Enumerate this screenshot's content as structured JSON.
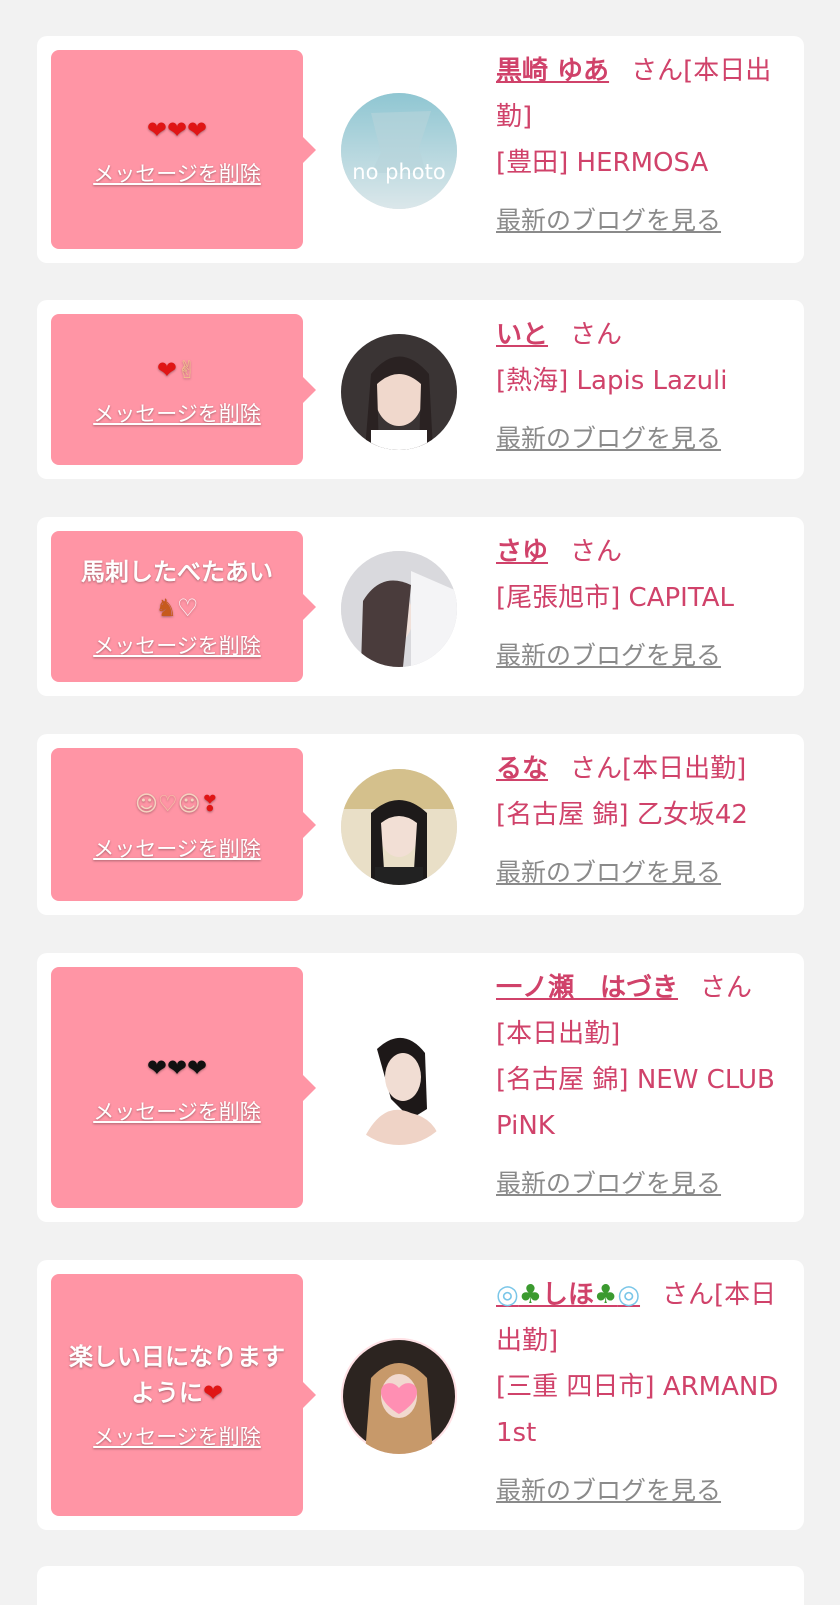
{
  "common": {
    "delete_label": "メッセージを削除",
    "blog_label": "最新のブログを見る",
    "san": "さん",
    "no_photo": "no photo"
  },
  "cards": [
    {
      "message_icons": [
        "heart-icon",
        "heart-icon",
        "heart-icon"
      ],
      "message_text": "",
      "name": "黒崎 ゆあ",
      "status": "[本日出勤]",
      "shop": "[豊田] HERMOSA",
      "avatar": "no-photo-avatar"
    },
    {
      "message_icons": [
        "heart-icon",
        "victory-hand-icon"
      ],
      "message_text": "",
      "name": "いと",
      "status": "",
      "shop": "[熱海] Lapis Lazuli",
      "avatar": "photo-avatar"
    },
    {
      "message_icons": [
        "horse-icon",
        "white-heart-icon"
      ],
      "message_text": "馬刺したべたあい",
      "name": "さゆ",
      "status": "",
      "shop": "[尾張旭市] CAPITAL",
      "avatar": "photo-avatar"
    },
    {
      "message_icons": [
        "angel-face-icon",
        "heart-hands-icon",
        "angel-face-icon",
        "two-hearts-icon"
      ],
      "message_text": "",
      "name": "るな",
      "status": "[本日出勤]",
      "shop": "[名古屋 錦] 乙女坂42",
      "avatar": "photo-avatar"
    },
    {
      "message_icons": [
        "black-heart-icon",
        "black-heart-icon",
        "black-heart-icon"
      ],
      "message_text": "",
      "name": "一ノ瀬　はづき",
      "status": "[本日出勤]",
      "shop": "[名古屋 錦] NEW CLUB PiNK",
      "avatar": "photo-avatar"
    },
    {
      "message_icons": [
        "sparkling-heart-icon"
      ],
      "message_text": "楽しい日になりますように",
      "name": "しほ",
      "name_icons": [
        "bubbles-icon",
        "palm-tree-icon",
        "palm-tree-icon",
        "bubbles-icon"
      ],
      "status": "[本日出勤]",
      "shop": "[三重 四日市] ARMAND 1st",
      "avatar": "photo-avatar"
    }
  ],
  "colors": {
    "page_bg": "#f2f2f2",
    "card_bg": "#ffffff",
    "bubble_bg": "#ff95a5",
    "name_color": "#d0426a",
    "blog_link": "#8a8a8a"
  }
}
